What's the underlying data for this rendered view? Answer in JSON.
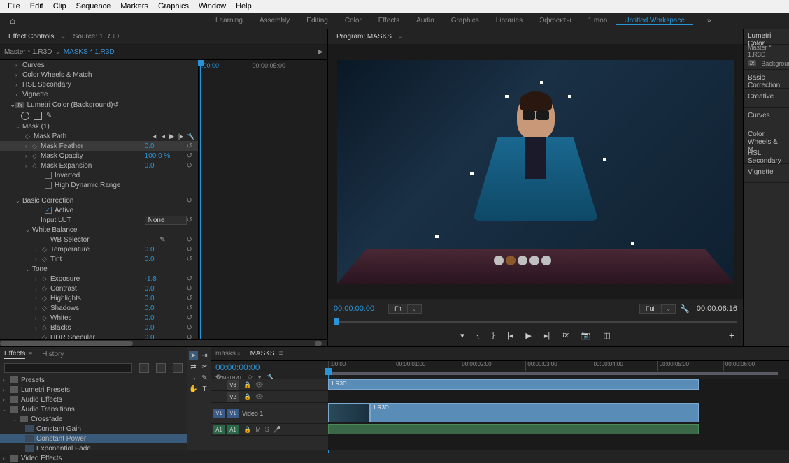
{
  "menubar": [
    "File",
    "Edit",
    "Clip",
    "Sequence",
    "Markers",
    "Graphics",
    "Window",
    "Help"
  ],
  "workspaces": {
    "items": [
      "Learning",
      "Assembly",
      "Editing",
      "Color",
      "Effects",
      "Audio",
      "Graphics",
      "Libraries",
      "Эффекты",
      "1 mon",
      "Untitled Workspace"
    ],
    "active": "Untitled Workspace"
  },
  "effect_controls": {
    "panel_title": "Effect Controls",
    "source_label": "Source: 1.R3D",
    "master": "Master * 1.R3D",
    "clip": "MASKS * 1.R3D",
    "mini_tc_cur": ":00:00",
    "mini_tc_end": "00:00:05:00",
    "sections": {
      "curves": "Curves",
      "color_wheels": "Color Wheels & Match",
      "hsl": "HSL Secondary",
      "vignette": "Vignette",
      "lumetri": "Lumetri Color (Background)",
      "mask": "Mask (1)",
      "mask_path": "Mask Path",
      "mask_feather": "Mask Feather",
      "mask_feather_val": "0.0",
      "mask_opacity": "Mask Opacity",
      "mask_opacity_val": "100.0 %",
      "mask_expansion": "Mask Expansion",
      "mask_expansion_val": "0.0",
      "inverted": "Inverted",
      "hdr": "High Dynamic Range",
      "basic_correction": "Basic Correction",
      "active": "Active",
      "input_lut": "Input LUT",
      "input_lut_val": "None",
      "white_balance": "White Balance",
      "wb_selector": "WB Selector",
      "temperature": "Temperature",
      "temperature_val": "0.0",
      "tint": "Tint",
      "tint_val": "0.0",
      "tone": "Tone",
      "exposure": "Exposure",
      "exposure_val": "-1.8",
      "contrast": "Contrast",
      "contrast_val": "0.0",
      "highlights": "Highlights",
      "highlights_val": "0.0",
      "shadows": "Shadows",
      "shadows_val": "0.0",
      "whites": "Whites",
      "whites_val": "0.0",
      "blacks": "Blacks",
      "blacks_val": "0.0",
      "hdr_spec": "HDR Specular",
      "hdr_spec_val": "0.0"
    }
  },
  "program": {
    "panel_title": "Program: MASKS",
    "tc_current": "00:00:00:00",
    "fit": "Fit",
    "full": "Full",
    "duration": "00:00:06:16"
  },
  "lumetri": {
    "title": "Lumetri Color",
    "master": "Master * 1.R3D",
    "bg": "Background",
    "sections": [
      "Basic Correction",
      "Creative",
      "Curves",
      "Color Wheels & M",
      "HSL Secondary",
      "Vignette"
    ]
  },
  "effects_browser": {
    "tab1": "Effects",
    "tab2": "History",
    "tree": [
      {
        "label": "Presets",
        "open": false,
        "indent": 0
      },
      {
        "label": "Lumetri Presets",
        "open": false,
        "indent": 0
      },
      {
        "label": "Audio Effects",
        "open": false,
        "indent": 0
      },
      {
        "label": "Audio Transitions",
        "open": true,
        "indent": 0
      },
      {
        "label": "Crossfade",
        "open": true,
        "indent": 1
      },
      {
        "label": "Constant Gain",
        "leaf": true,
        "indent": 2
      },
      {
        "label": "Constant Power",
        "leaf": true,
        "indent": 2,
        "selected": true
      },
      {
        "label": "Exponential Fade",
        "leaf": true,
        "indent": 2
      },
      {
        "label": "Video Effects",
        "open": false,
        "indent": 0
      }
    ]
  },
  "timeline": {
    "tab1": "masks",
    "tab2": "MASKS",
    "tc": "00:00:00:00",
    "ruler": [
      ":00:00",
      "00:00:01:00",
      "00:00:02:00",
      "00:00:03:00",
      "00:00:04:00",
      "00:00:05:00",
      "00:00:06:00"
    ],
    "tracks": {
      "v3": "V3",
      "v2": "V2",
      "v1": "V1",
      "video1": "Video 1",
      "a1": "A1",
      "m": "M",
      "s": "S"
    },
    "clip_name": "1.R3D"
  }
}
